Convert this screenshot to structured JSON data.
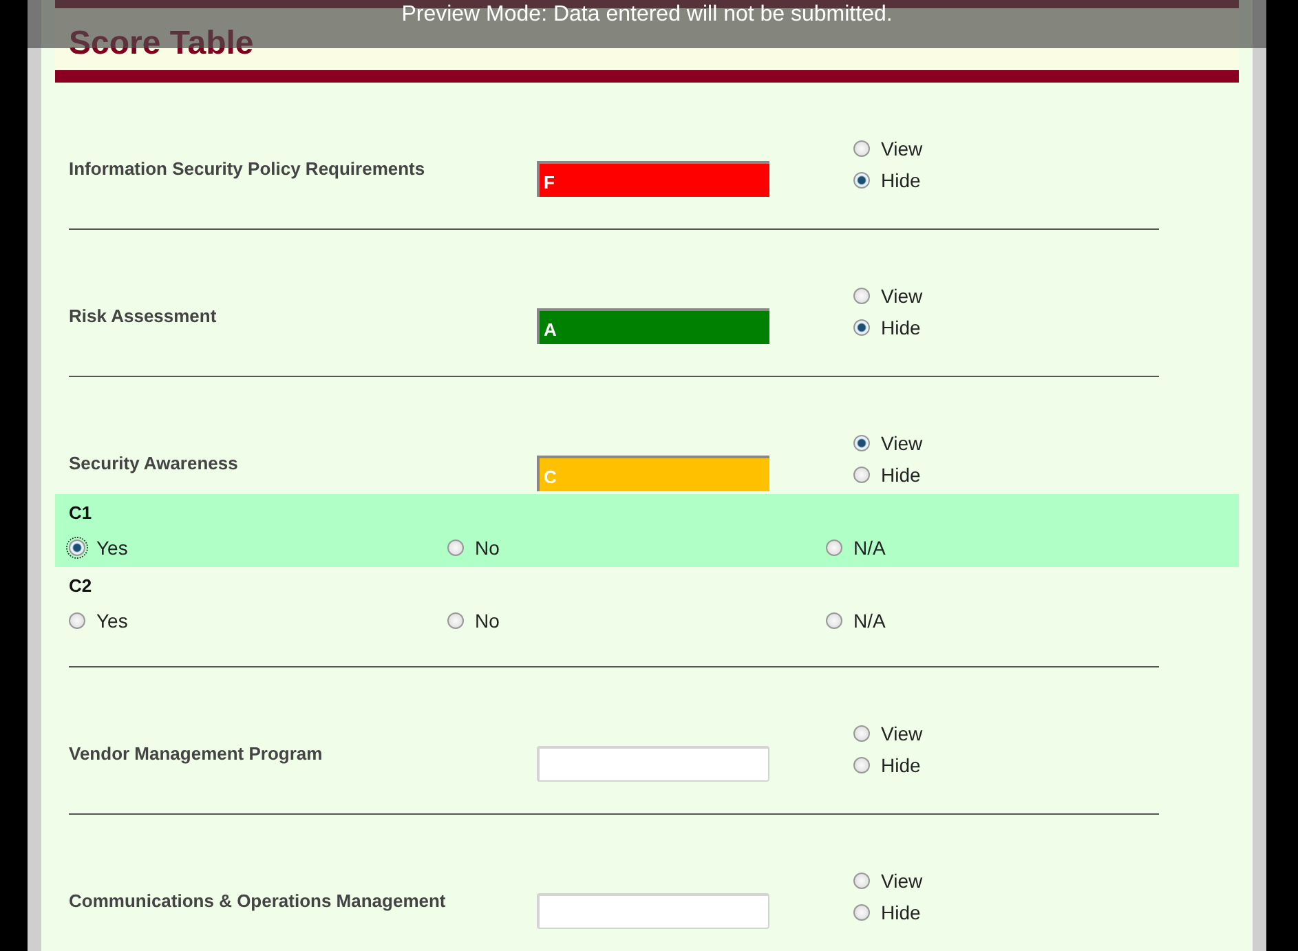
{
  "banner": "Preview Mode: Data entered will not be submitted.",
  "title": "Score Table",
  "sections": [
    {
      "label": "Information Security Policy Requirements",
      "grade": {
        "value": "F",
        "color": "#ff0000"
      },
      "options": [
        {
          "label": "View",
          "selected": false
        },
        {
          "label": "Hide",
          "selected": true
        }
      ]
    },
    {
      "label": "Risk Assessment",
      "grade": {
        "value": "A",
        "color": "#008000"
      },
      "options": [
        {
          "label": "View",
          "selected": false
        },
        {
          "label": "Hide",
          "selected": true
        }
      ]
    },
    {
      "label": "Security Awareness",
      "grade": {
        "value": "C",
        "color": "#ffc000"
      },
      "options": [
        {
          "label": "View",
          "selected": true
        },
        {
          "label": "Hide",
          "selected": false
        }
      ],
      "questions": [
        {
          "label": "C1",
          "highlighted": true,
          "options": [
            {
              "label": "Yes",
              "selected": true
            },
            {
              "label": "No",
              "selected": false
            },
            {
              "label": "N/A",
              "selected": false
            }
          ]
        },
        {
          "label": "C2",
          "highlighted": false,
          "options": [
            {
              "label": "Yes",
              "selected": false
            },
            {
              "label": "No",
              "selected": false
            },
            {
              "label": "N/A",
              "selected": false
            }
          ]
        }
      ]
    },
    {
      "label": "Vendor Management Program",
      "options": [
        {
          "label": "View",
          "selected": false
        },
        {
          "label": "Hide",
          "selected": false
        }
      ]
    },
    {
      "label": "Communications & Operations Management",
      "options": [
        {
          "label": "View",
          "selected": false
        },
        {
          "label": "Hide",
          "selected": false
        }
      ]
    }
  ]
}
